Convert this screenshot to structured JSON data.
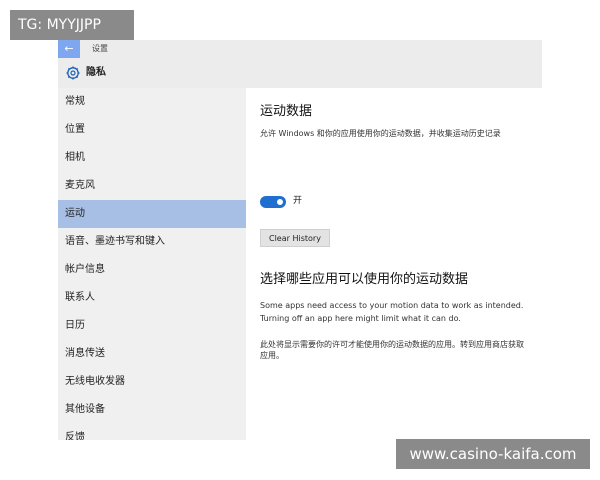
{
  "watermark": {
    "top_left": "TG: MYYJJPP",
    "bottom_right": "www.casino-kaifa.com"
  },
  "window": {
    "back_icon": "arrow-left-icon",
    "title": "设置"
  },
  "header": {
    "icon": "gear-icon",
    "title": "隐私"
  },
  "sidebar": {
    "items": [
      {
        "label": "常规"
      },
      {
        "label": "位置"
      },
      {
        "label": "相机"
      },
      {
        "label": "麦克风"
      },
      {
        "label": "运动",
        "active": true
      },
      {
        "label": "语音、墨迹书写和键入"
      },
      {
        "label": "帐户信息"
      },
      {
        "label": "联系人"
      },
      {
        "label": "日历"
      },
      {
        "label": "消息传送"
      },
      {
        "label": "无线电收发器"
      },
      {
        "label": "其他设备"
      },
      {
        "label": "反馈"
      }
    ]
  },
  "content": {
    "section1_title": "运动数据",
    "section1_desc": "允许 Windows 和你的应用使用你的运动数据，并收集运动历史记录",
    "toggle_state": "开",
    "toggle_on": true,
    "clear_button": "Clear History",
    "section2_title": "选择哪些应用可以使用你的运动数据",
    "section2_desc": "Some apps need access to your motion data to work as intended. Turning off an app here might limit what it can do.",
    "section2_note": "此处将显示需要你的许可才能使用你的运动数据的应用。转到应用商店获取应用。"
  },
  "colors": {
    "accent": "#1f6fd0",
    "selected_nav": "#a7bfe4",
    "sidebar_bg": "#f0f0f0",
    "header_bg": "#ececec"
  }
}
